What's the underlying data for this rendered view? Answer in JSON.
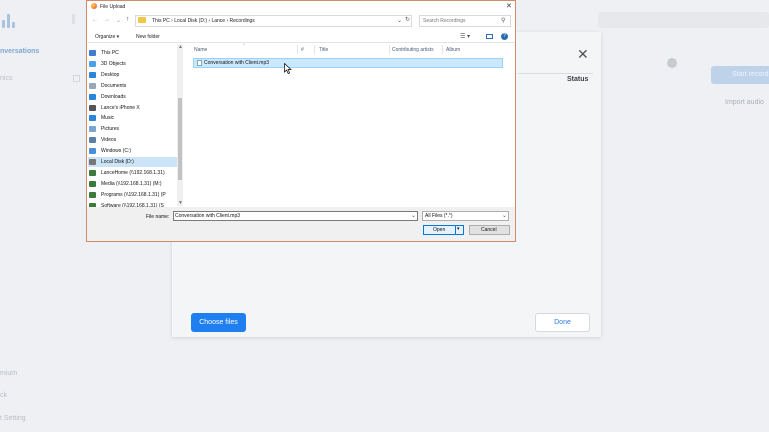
{
  "app": {
    "nav": {
      "active_label": "nversations",
      "items": [
        "nics",
        "mium",
        "ck",
        "t Setting"
      ]
    },
    "start_button_label": "Start recording",
    "import_link": "Import audio"
  },
  "upload_modal": {
    "status_header": "Status",
    "close_icon": "close-icon",
    "choose_files_label": "Choose files",
    "done_label": "Done"
  },
  "file_dialog": {
    "title": "File Upload",
    "breadcrumb": "This PC  ›  Local Disk (D:)  ›  Lance  ›  Recordings",
    "search_placeholder": "Search Recordings",
    "toolbar": {
      "organize_label": "Organize ▾",
      "new_folder_label": "New folder"
    },
    "tree": [
      {
        "label": "This PC",
        "icon": "computer-icon",
        "color": "#3d7dcc"
      },
      {
        "label": "3D Objects",
        "icon": "cube-icon",
        "color": "#4aa3e8"
      },
      {
        "label": "Desktop",
        "icon": "desktop-icon",
        "color": "#2b86d9"
      },
      {
        "label": "Documents",
        "icon": "documents-icon",
        "color": "#9aa7b5"
      },
      {
        "label": "Downloads",
        "icon": "download-icon",
        "color": "#2b86d9"
      },
      {
        "label": "Lance's iPhone X",
        "icon": "phone-icon",
        "color": "#555555"
      },
      {
        "label": "Music",
        "icon": "music-icon",
        "color": "#2b86d9"
      },
      {
        "label": "Pictures",
        "icon": "pictures-icon",
        "color": "#7aa5d1"
      },
      {
        "label": "Videos",
        "icon": "videos-icon",
        "color": "#5a7fa8"
      },
      {
        "label": "Windows (C:)",
        "icon": "drive-icon",
        "color": "#4a90d9"
      },
      {
        "label": "Local Disk (D:)",
        "icon": "drive-icon",
        "color": "#777777"
      },
      {
        "label": "LanceHome (\\\\192.168.1.31)",
        "icon": "network-drive-icon",
        "color": "#3c7a3c"
      },
      {
        "label": "Media (\\\\192.168.1.31) (M:)",
        "icon": "network-drive-icon",
        "color": "#3c7a3c"
      },
      {
        "label": "Programs (\\\\192.168.1.31) (P",
        "icon": "network-drive-icon",
        "color": "#3c7a3c"
      },
      {
        "label": "Software (\\\\192.168.1.31) (S",
        "icon": "network-drive-icon",
        "color": "#3c7a3c"
      }
    ],
    "selected_tree_label": "Local Disk (D:)",
    "columns": [
      "Name",
      "#",
      "Title",
      "Contributing artists",
      "Album"
    ],
    "files": [
      {
        "name": "Conversation with Client.mp3",
        "icon": "audio-file-icon"
      }
    ],
    "file_name_label": "File name:",
    "file_name_value": "Conversation with Client.mp3",
    "file_type_value": "All Files (*.*)",
    "open_label": "Open",
    "cancel_label": "Cancel"
  }
}
